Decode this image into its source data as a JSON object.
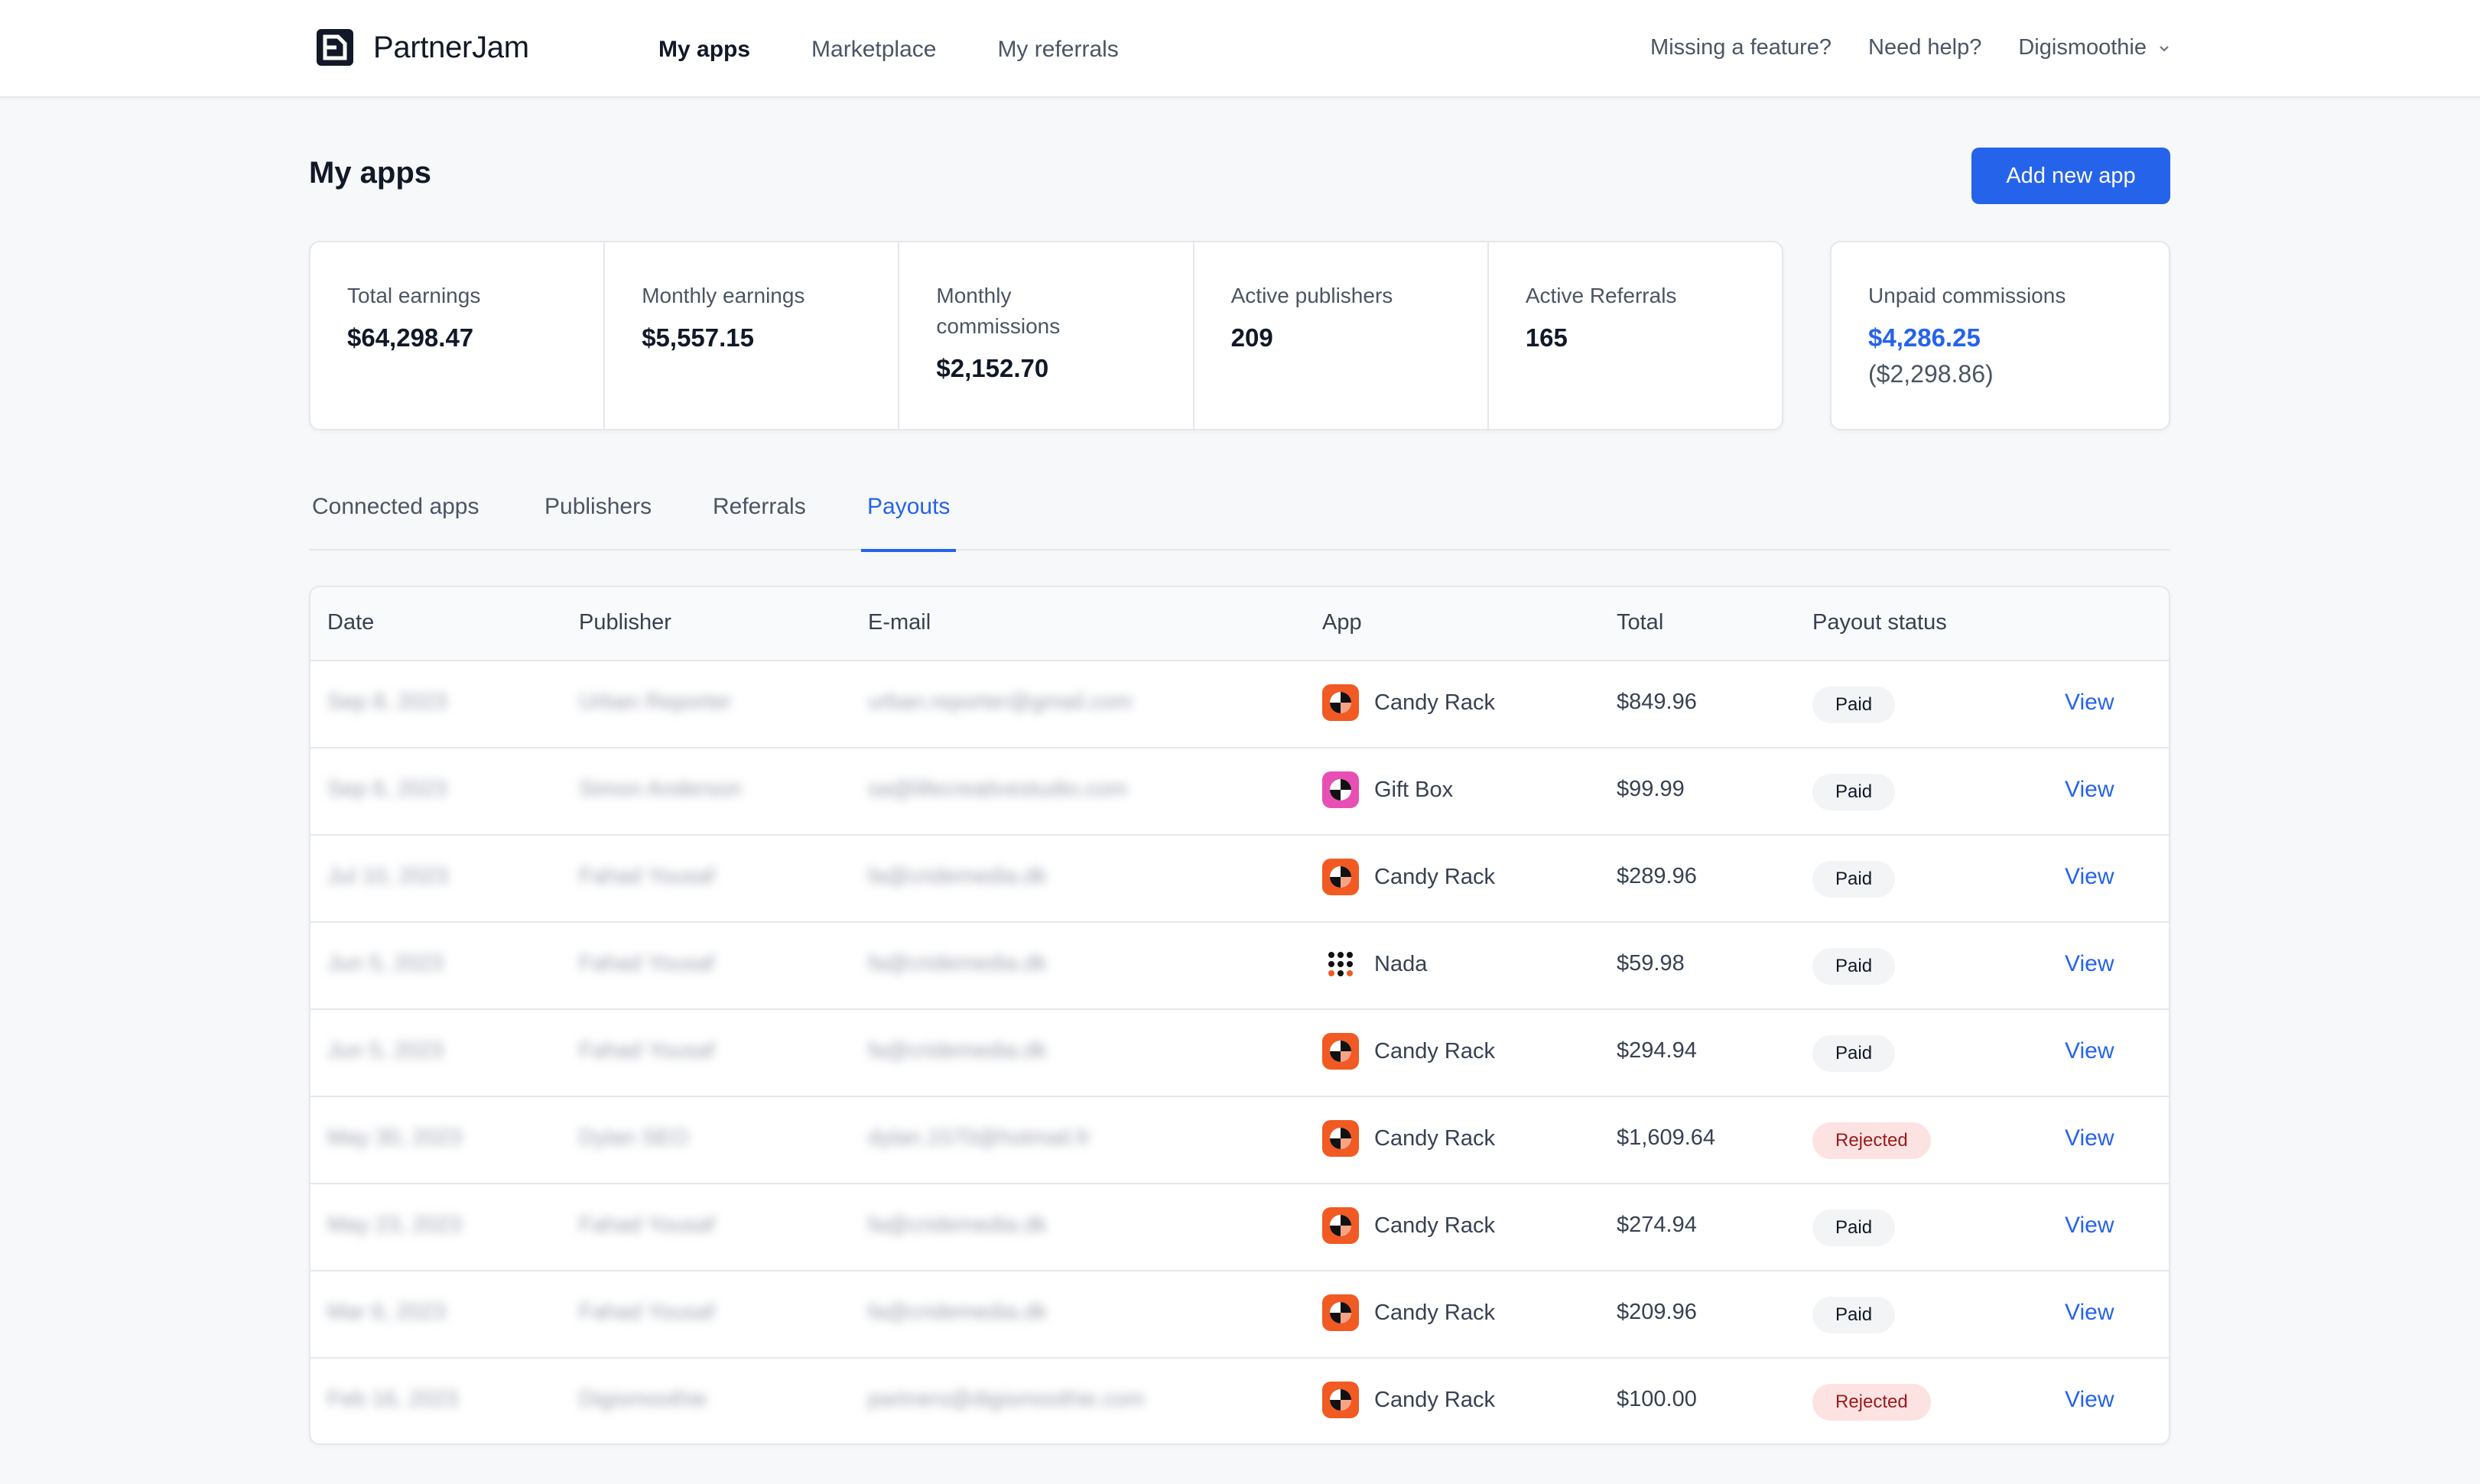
{
  "header": {
    "brand": "PartnerJam",
    "nav": [
      {
        "label": "My apps",
        "active": true
      },
      {
        "label": "Marketplace",
        "active": false
      },
      {
        "label": "My referrals",
        "active": false
      }
    ],
    "missing_feature": "Missing a feature?",
    "need_help": "Need help?",
    "org_name": "Digismoothie"
  },
  "page": {
    "title": "My apps",
    "add_button": "Add new app"
  },
  "stats": [
    {
      "label": "Total earnings",
      "value": "$64,298.47"
    },
    {
      "label": "Monthly earnings",
      "value": "$5,557.15"
    },
    {
      "label": "Monthly commissions",
      "value": "$2,152.70"
    },
    {
      "label": "Active publishers",
      "value": "209"
    },
    {
      "label": "Active Referrals",
      "value": "165"
    }
  ],
  "unpaid": {
    "label": "Unpaid commissions",
    "value": "$4,286.25",
    "sub": "($2,298.86)"
  },
  "tabs": [
    {
      "label": "Connected apps",
      "active": false
    },
    {
      "label": "Publishers",
      "active": false
    },
    {
      "label": "Referrals",
      "active": false
    },
    {
      "label": "Payouts",
      "active": true
    }
  ],
  "table": {
    "headers": [
      "Date",
      "Publisher",
      "E-mail",
      "App",
      "Total",
      "Payout status"
    ],
    "rows": [
      {
        "date": "Sep 8, 2023",
        "publisher": "Urban Reporter",
        "email": "urban.reporter@gmail.com",
        "app": "Candy Rack",
        "app_icon": "candy-rack-icon",
        "total": "$849.96",
        "status": "Paid",
        "action": "View"
      },
      {
        "date": "Sep 6, 2023",
        "publisher": "Simon Anderson",
        "email": "sa@lifecreativestudio.com",
        "app": "Gift Box",
        "app_icon": "gift-box-icon",
        "total": "$99.99",
        "status": "Paid",
        "action": "View"
      },
      {
        "date": "Jul 10, 2023",
        "publisher": "Fahad Yousaf",
        "email": "fa@cridemedia.dk",
        "app": "Candy Rack",
        "app_icon": "candy-rack-icon",
        "total": "$289.96",
        "status": "Paid",
        "action": "View"
      },
      {
        "date": "Jun 5, 2023",
        "publisher": "Fahad Yousaf",
        "email": "fa@cridemedia.dk",
        "app": "Nada",
        "app_icon": "nada-icon",
        "total": "$59.98",
        "status": "Paid",
        "action": "View"
      },
      {
        "date": "Jun 5, 2023",
        "publisher": "Fahad Yousaf",
        "email": "fa@cridemedia.dk",
        "app": "Candy Rack",
        "app_icon": "candy-rack-icon",
        "total": "$294.94",
        "status": "Paid",
        "action": "View"
      },
      {
        "date": "May 30, 2023",
        "publisher": "Dylan SEO",
        "email": "dylan.1570@hotmail.fr",
        "app": "Candy Rack",
        "app_icon": "candy-rack-icon",
        "total": "$1,609.64",
        "status": "Rejected",
        "action": "View"
      },
      {
        "date": "May 23, 2023",
        "publisher": "Fahad Yousaf",
        "email": "fa@cridemedia.dk",
        "app": "Candy Rack",
        "app_icon": "candy-rack-icon",
        "total": "$274.94",
        "status": "Paid",
        "action": "View"
      },
      {
        "date": "Mar 6, 2023",
        "publisher": "Fahad Yousaf",
        "email": "fa@cridemedia.dk",
        "app": "Candy Rack",
        "app_icon": "candy-rack-icon",
        "total": "$209.96",
        "status": "Paid",
        "action": "View"
      },
      {
        "date": "Feb 16, 2023",
        "publisher": "Digismoothie",
        "email": "partners@digismoothie.com",
        "app": "Candy Rack",
        "app_icon": "candy-rack-icon",
        "total": "$100.00",
        "status": "Rejected",
        "action": "View"
      }
    ]
  },
  "colors": {
    "accent": "#2563eb",
    "candy_rack": "#f15a22",
    "gift_box": "#e84fb5",
    "rejected_bg": "#fde2e2",
    "paid_bg": "#f3f4f6"
  }
}
